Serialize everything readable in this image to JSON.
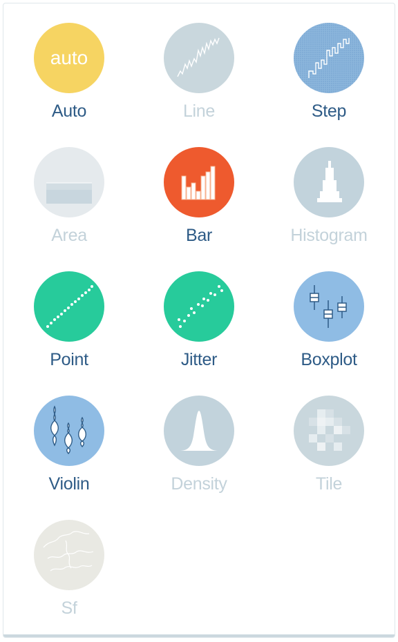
{
  "geoms": [
    {
      "key": "auto",
      "label": "Auto",
      "enabled": true,
      "icon": "auto-icon",
      "color": "#f6d462",
      "icon_text": "auto"
    },
    {
      "key": "line",
      "label": "Line",
      "enabled": false,
      "icon": "line-icon",
      "color": "#c9d7dd"
    },
    {
      "key": "step",
      "label": "Step",
      "enabled": true,
      "icon": "step-icon",
      "color": "#8cb6dc"
    },
    {
      "key": "area",
      "label": "Area",
      "enabled": false,
      "icon": "area-icon",
      "color": "#e5eaed"
    },
    {
      "key": "bar",
      "label": "Bar",
      "enabled": true,
      "icon": "bar-icon",
      "color": "#ee5a2e"
    },
    {
      "key": "histogram",
      "label": "Histogram",
      "enabled": false,
      "icon": "histogram-icon",
      "color": "#c2d3dc"
    },
    {
      "key": "point",
      "label": "Point",
      "enabled": true,
      "icon": "point-icon",
      "color": "#27cb9b"
    },
    {
      "key": "jitter",
      "label": "Jitter",
      "enabled": true,
      "icon": "jitter-icon",
      "color": "#27cb9b"
    },
    {
      "key": "boxplot",
      "label": "Boxplot",
      "enabled": true,
      "icon": "boxplot-icon",
      "color": "#8fbce4"
    },
    {
      "key": "violin",
      "label": "Violin",
      "enabled": true,
      "icon": "violin-icon",
      "color": "#8fbce4"
    },
    {
      "key": "density",
      "label": "Density",
      "enabled": false,
      "icon": "density-icon",
      "color": "#c2d3dc"
    },
    {
      "key": "tile",
      "label": "Tile",
      "enabled": false,
      "icon": "tile-icon",
      "color": "#c9d7dd"
    },
    {
      "key": "sf",
      "label": "Sf",
      "enabled": false,
      "icon": "globe-icon",
      "color": "#e9e9e3"
    }
  ]
}
